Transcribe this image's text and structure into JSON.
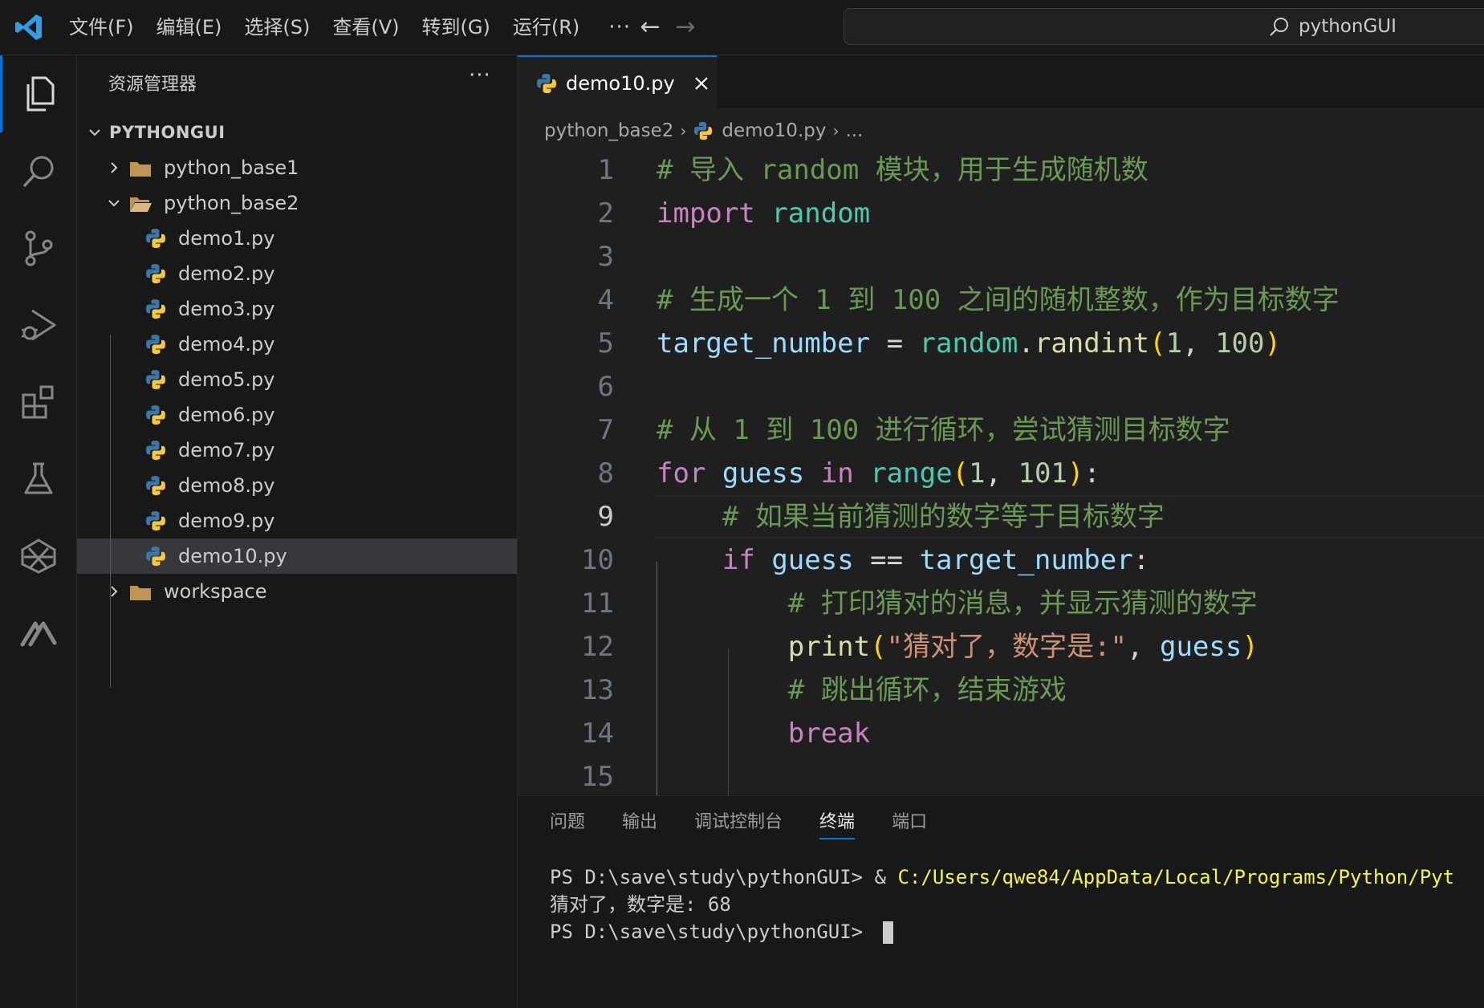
{
  "title_bar": {
    "menu": [
      "文件(F)",
      "编辑(E)",
      "选择(S)",
      "查看(V)",
      "转到(G)",
      "运行(R)"
    ],
    "more": "···",
    "search_text": "pythonGUI"
  },
  "activity_bar": {
    "icons": [
      "explorer-icon",
      "search-icon",
      "source-control-icon",
      "run-debug-icon",
      "extensions-icon",
      "testing-icon",
      "remote-icon",
      "copilot-icon"
    ],
    "active": "explorer-icon"
  },
  "explorer": {
    "title": "资源管理器",
    "more": "···",
    "root": "PYTHONGUI",
    "folder1": "python_base1",
    "folder2": "python_base2",
    "files": [
      "demo1.py",
      "demo2.py",
      "demo3.py",
      "demo4.py",
      "demo5.py",
      "demo6.py",
      "demo7.py",
      "demo8.py",
      "demo9.py",
      "demo10.py"
    ],
    "selected_file": "demo10.py",
    "folder3": "workspace"
  },
  "editor": {
    "tab_label": "demo10.py",
    "breadcrumb": {
      "folder": "python_base2",
      "file": "demo10.py",
      "more": "..."
    },
    "current_line": 9,
    "lines": [
      [
        {
          "t": "# 导入 random 模块，用于生成随机数",
          "c": "cm"
        }
      ],
      [
        {
          "t": "import",
          "c": "kw"
        },
        {
          "t": " ",
          "c": "op"
        },
        {
          "t": "random",
          "c": "mod"
        }
      ],
      [],
      [
        {
          "t": "# 生成一个 1 到 100 之间的随机整数，作为目标数字",
          "c": "cm"
        }
      ],
      [
        {
          "t": "target_number",
          "c": "var"
        },
        {
          "t": " = ",
          "c": "op"
        },
        {
          "t": "random",
          "c": "mod"
        },
        {
          "t": ".",
          "c": "op"
        },
        {
          "t": "randint",
          "c": "fn"
        },
        {
          "t": "(",
          "c": "br"
        },
        {
          "t": "1",
          "c": "num"
        },
        {
          "t": ", ",
          "c": "op"
        },
        {
          "t": "100",
          "c": "num"
        },
        {
          "t": ")",
          "c": "br"
        }
      ],
      [],
      [
        {
          "t": "# 从 1 到 100 进行循环，尝试猜测目标数字",
          "c": "cm"
        }
      ],
      [
        {
          "t": "for",
          "c": "kw"
        },
        {
          "t": " ",
          "c": "op"
        },
        {
          "t": "guess",
          "c": "var"
        },
        {
          "t": " ",
          "c": "op"
        },
        {
          "t": "in",
          "c": "kw"
        },
        {
          "t": " ",
          "c": "op"
        },
        {
          "t": "range",
          "c": "mod"
        },
        {
          "t": "(",
          "c": "br"
        },
        {
          "t": "1",
          "c": "num"
        },
        {
          "t": ", ",
          "c": "op"
        },
        {
          "t": "101",
          "c": "num"
        },
        {
          "t": ")",
          "c": "br"
        },
        {
          "t": ":",
          "c": "op"
        }
      ],
      [
        {
          "t": "    ",
          "c": "op"
        },
        {
          "t": "# 如果当前猜测的数字等于目标数字",
          "c": "cm"
        }
      ],
      [
        {
          "t": "    ",
          "c": "op"
        },
        {
          "t": "if",
          "c": "kw"
        },
        {
          "t": " ",
          "c": "op"
        },
        {
          "t": "guess",
          "c": "var"
        },
        {
          "t": " == ",
          "c": "op"
        },
        {
          "t": "target_number",
          "c": "var"
        },
        {
          "t": ":",
          "c": "op"
        }
      ],
      [
        {
          "t": "        ",
          "c": "op"
        },
        {
          "t": "# 打印猜对的消息，并显示猜测的数字",
          "c": "cm"
        }
      ],
      [
        {
          "t": "        ",
          "c": "op"
        },
        {
          "t": "print",
          "c": "fn"
        },
        {
          "t": "(",
          "c": "br"
        },
        {
          "t": "\"猜对了，数字是:\"",
          "c": "str"
        },
        {
          "t": ", ",
          "c": "op"
        },
        {
          "t": "guess",
          "c": "var"
        },
        {
          "t": ")",
          "c": "br"
        }
      ],
      [
        {
          "t": "        ",
          "c": "op"
        },
        {
          "t": "# 跳出循环，结束游戏",
          "c": "cm"
        }
      ],
      [
        {
          "t": "        ",
          "c": "op"
        },
        {
          "t": "break",
          "c": "kw"
        }
      ],
      []
    ]
  },
  "panel": {
    "tabs": [
      "问题",
      "输出",
      "调试控制台",
      "终端",
      "端口"
    ],
    "active_tab": "终端",
    "terminal": {
      "line1_prompt": "PS D:\\save\\study\\pythonGUI> & ",
      "line1_path": "C:/Users/qwe84/AppData/Local/Programs/Python/Pyt",
      "line2": "猜对了，数字是: 68",
      "line3_prompt": "PS D:\\save\\study\\pythonGUI> "
    }
  },
  "colors": {
    "accent": "#0078d4",
    "comment": "#6a9955",
    "keyword": "#c586c0",
    "module": "#4ec9b0",
    "variable": "#9cdcfe",
    "function": "#dcdcaa",
    "number": "#b5cea8",
    "string": "#ce9178",
    "bracket": "#ffd700"
  }
}
